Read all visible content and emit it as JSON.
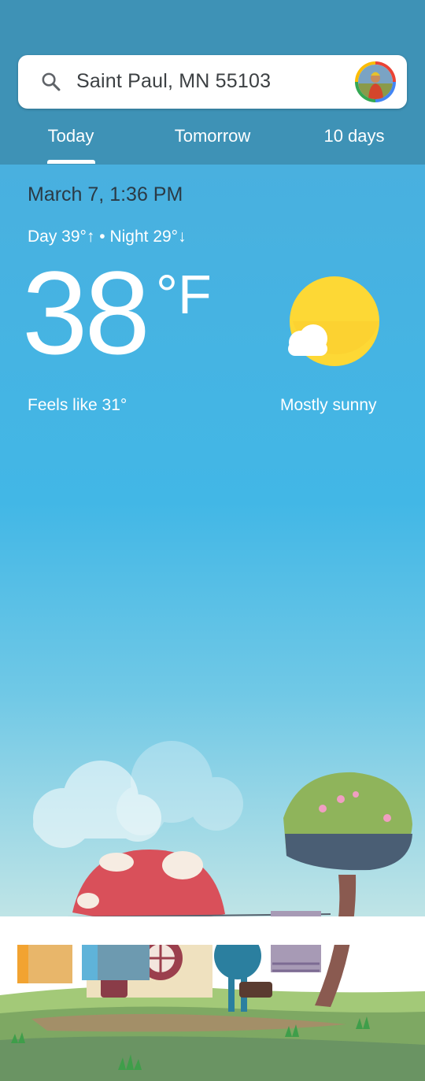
{
  "search": {
    "location": "Saint Paul, MN 55103",
    "icon": "search-icon"
  },
  "tabs": [
    {
      "label": "Today",
      "selected": true
    },
    {
      "label": "Tomorrow",
      "selected": false
    },
    {
      "label": "10 days",
      "selected": false
    }
  ],
  "weather": {
    "datetime": "March 7, 1:36 PM",
    "day_night": "Day 39°↑ • Night 29°↓",
    "temperature": "38",
    "unit": "°F",
    "feels_like": "Feels like 31°",
    "condition": "Mostly sunny",
    "icon": "mostly-sunny-icon"
  },
  "colors": {
    "header": "#3e92b6",
    "sky_top": "#49b0df",
    "sun": "#fdd835",
    "datetime_text": "#2b3a45"
  }
}
